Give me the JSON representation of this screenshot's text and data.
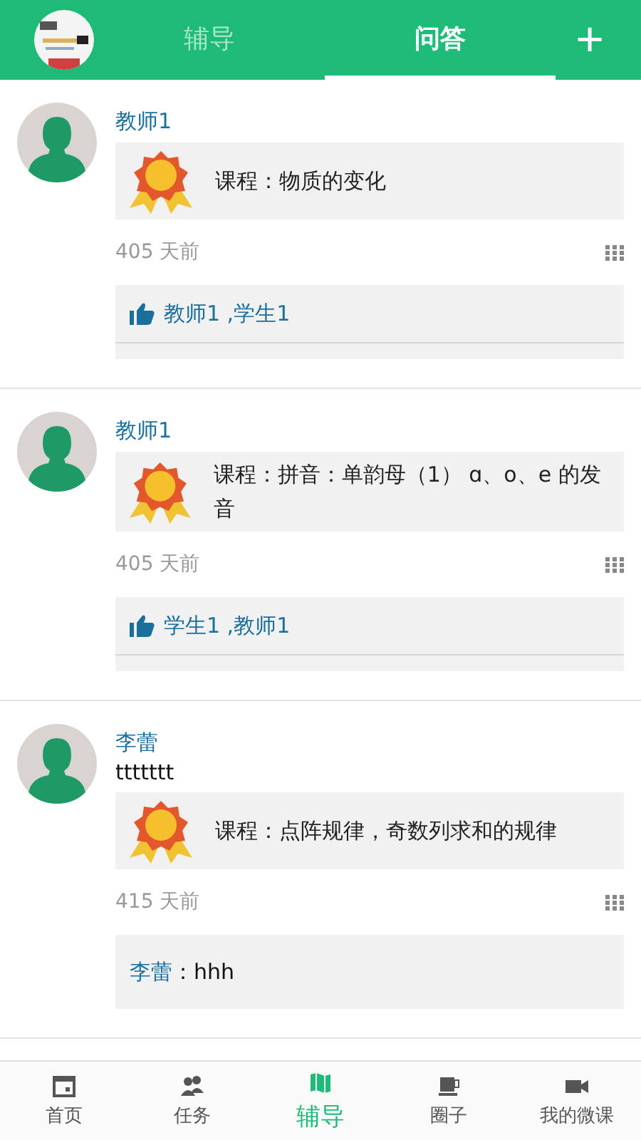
{
  "header": {
    "tabs": [
      {
        "label": "辅导",
        "selected": false
      },
      {
        "label": "问答",
        "selected": true
      }
    ],
    "add_button": "+"
  },
  "posts": [
    {
      "author": "教师1",
      "course": "课程：物质的变化",
      "time": "405 天前",
      "feedback": {
        "kind": "likes",
        "text": "教师1 ,学生1"
      }
    },
    {
      "author": "教师1",
      "course": "课程：拼音：单韵母（1） ɑ、o、e 的发音",
      "time": "405 天前",
      "feedback": {
        "kind": "likes",
        "text": "学生1 ,教师1"
      }
    },
    {
      "author": "李蕾",
      "text": "ttttttt",
      "course": "课程：点阵规律，奇数列求和的规律",
      "time": "415 天前",
      "feedback": {
        "kind": "comment",
        "author": "李蕾",
        "text": "：hhh"
      }
    }
  ],
  "bottom_nav": [
    {
      "label": "首页",
      "kind": "calendar",
      "selected": false
    },
    {
      "label": "任务",
      "kind": "people",
      "selected": false
    },
    {
      "label": "辅导",
      "kind": "map",
      "selected": true
    },
    {
      "label": "圈子",
      "kind": "cup",
      "selected": false
    },
    {
      "label": "我的微课",
      "kind": "video",
      "selected": false
    }
  ]
}
